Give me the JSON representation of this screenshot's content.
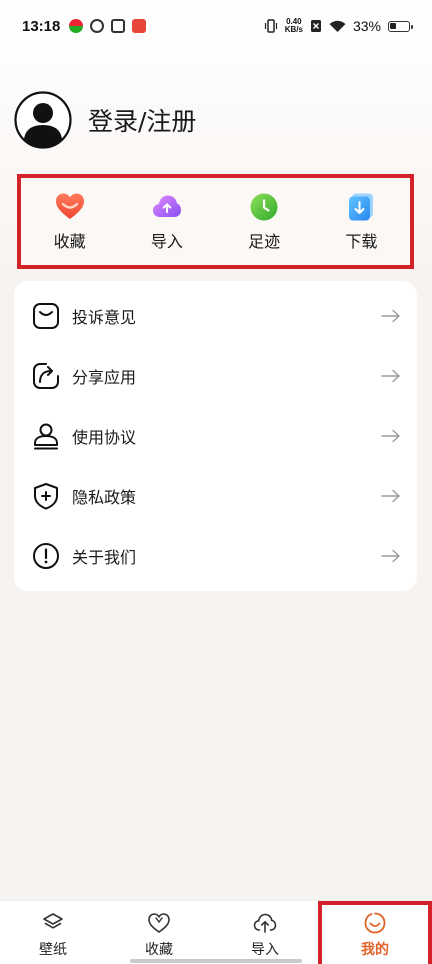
{
  "status_bar": {
    "time": "13:18",
    "net_speed_value": "0.40",
    "net_speed_unit": "KB/s",
    "battery_percent": "33%",
    "battery_level": 0.33
  },
  "profile": {
    "login_label": "登录/注册"
  },
  "quick_actions": [
    {
      "label": "收藏",
      "icon": "heart-favorite-icon"
    },
    {
      "label": "导入",
      "icon": "cloud-upload-icon"
    },
    {
      "label": "足迹",
      "icon": "clock-history-icon"
    },
    {
      "label": "下载",
      "icon": "download-icon"
    }
  ],
  "menu": [
    {
      "label": "投诉意见",
      "icon": "feedback-icon"
    },
    {
      "label": "分享应用",
      "icon": "share-icon"
    },
    {
      "label": "使用协议",
      "icon": "user-agreement-icon"
    },
    {
      "label": "隐私政策",
      "icon": "privacy-shield-icon"
    },
    {
      "label": "关于我们",
      "icon": "info-icon"
    }
  ],
  "bottom_nav": [
    {
      "label": "壁纸",
      "icon": "layers-icon"
    },
    {
      "label": "收藏",
      "icon": "heart-outline-icon"
    },
    {
      "label": "导入",
      "icon": "cloud-upload-outline-icon"
    },
    {
      "label": "我的",
      "icon": "smile-face-icon",
      "active": true
    }
  ],
  "colors": {
    "accent": "#e0642b",
    "highlight_border": "#d3222a",
    "background": "#f7f3f0"
  }
}
